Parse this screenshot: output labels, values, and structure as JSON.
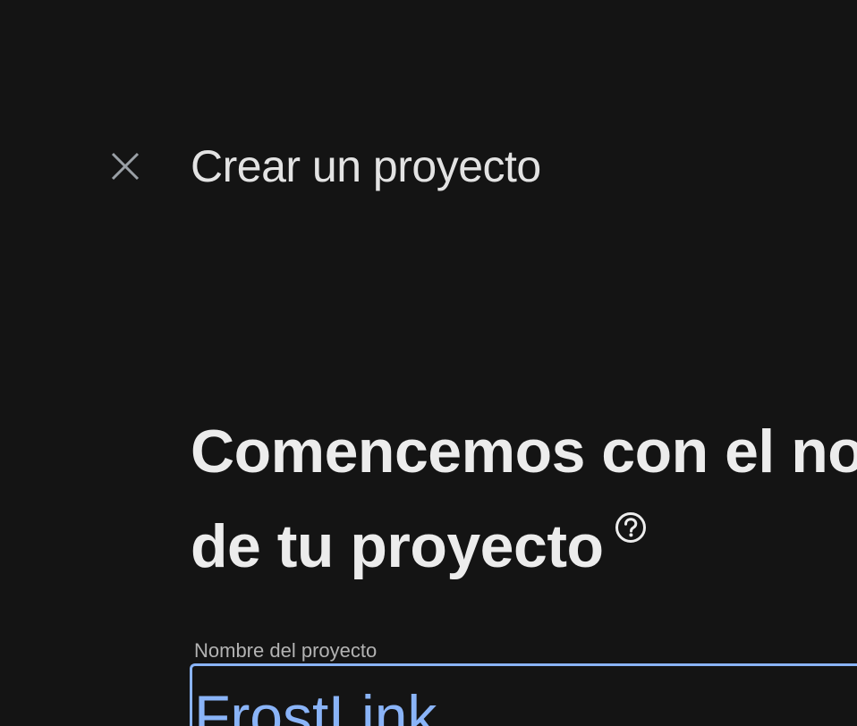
{
  "dialog": {
    "title": "Crear un proyecto",
    "close_icon": "close-icon"
  },
  "main": {
    "headline_line1": "Comencemos con el no",
    "headline_line2": "de tu proyecto",
    "help_icon": "help-circle-icon"
  },
  "project_name_field": {
    "label": "Nombre del proyecto",
    "value": "FrostLink"
  },
  "colors": {
    "background": "#141414",
    "text": "#e8eaed",
    "accent": "#8ab4f8",
    "label": "#b3b3b3"
  }
}
